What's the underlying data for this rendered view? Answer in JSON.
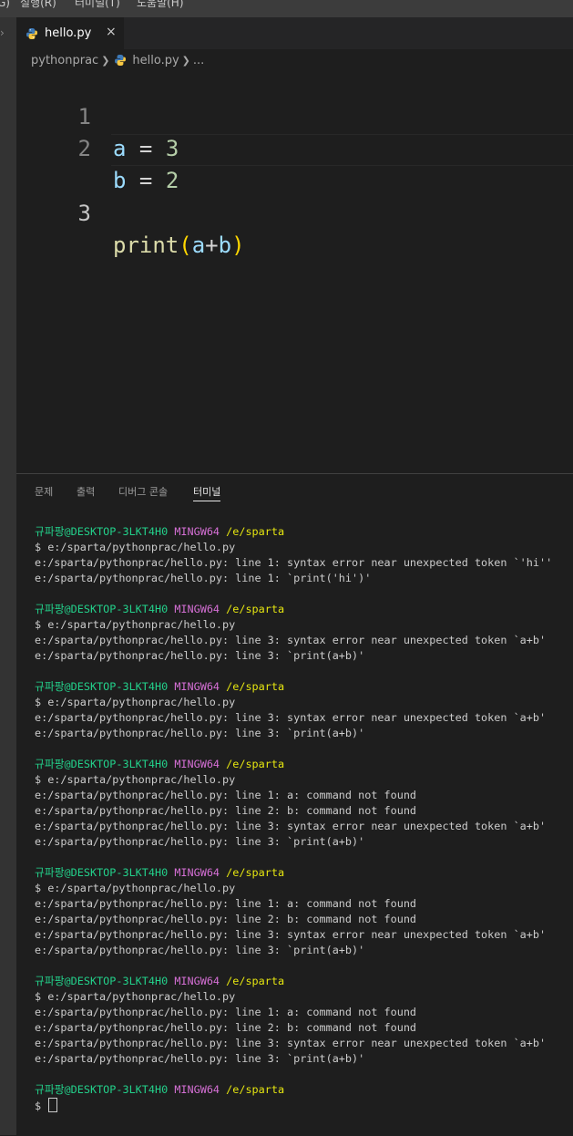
{
  "menu": [
    "G)",
    "실행(R)",
    "터미널(T)",
    "도움말(H)"
  ],
  "tab": {
    "label": "hello.py",
    "close": "×"
  },
  "breadcrumb": {
    "folder": "pythonprac",
    "file": "hello.py",
    "more": "..."
  },
  "editor": {
    "line_numbers": [
      "1",
      "2",
      "3"
    ],
    "line1": {
      "var": "a",
      "op": " = ",
      "num": "3"
    },
    "line2": {
      "var": "b",
      "op": " = ",
      "num": "2"
    },
    "line3": {
      "fn": "print",
      "open": "(",
      "a": "a",
      "plus": "+",
      "b": "b",
      "close": ")"
    }
  },
  "panel_tabs": [
    "문제",
    "출력",
    "디버그 콘솔",
    "터미널"
  ],
  "active_panel_tab": "터미널",
  "prompt": {
    "user": "규파팡@DESKTOP-3LKT4H0",
    "system": "MINGW64",
    "path": "/e/sparta"
  },
  "terminal_blocks": [
    {
      "command": "$ e:/sparta/pythonprac/hello.py",
      "output": [
        "e:/sparta/pythonprac/hello.py: line 1: syntax error near unexpected token `'hi''",
        "e:/sparta/pythonprac/hello.py: line 1: `print('hi')'"
      ]
    },
    {
      "command": "$ e:/sparta/pythonprac/hello.py",
      "output": [
        "e:/sparta/pythonprac/hello.py: line 3: syntax error near unexpected token `a+b'",
        "e:/sparta/pythonprac/hello.py: line 3: `print(a+b)'"
      ]
    },
    {
      "command": "$ e:/sparta/pythonprac/hello.py",
      "output": [
        "e:/sparta/pythonprac/hello.py: line 3: syntax error near unexpected token `a+b'",
        "e:/sparta/pythonprac/hello.py: line 3: `print(a+b)'"
      ]
    },
    {
      "command": "$ e:/sparta/pythonprac/hello.py",
      "output": [
        "e:/sparta/pythonprac/hello.py: line 1: a: command not found",
        "e:/sparta/pythonprac/hello.py: line 2: b: command not found",
        "e:/sparta/pythonprac/hello.py: line 3: syntax error near unexpected token `a+b'",
        "e:/sparta/pythonprac/hello.py: line 3: `print(a+b)'"
      ]
    },
    {
      "command": "$ e:/sparta/pythonprac/hello.py",
      "output": [
        "e:/sparta/pythonprac/hello.py: line 1: a: command not found",
        "e:/sparta/pythonprac/hello.py: line 2: b: command not found",
        "e:/sparta/pythonprac/hello.py: line 3: syntax error near unexpected token `a+b'",
        "e:/sparta/pythonprac/hello.py: line 3: `print(a+b)'"
      ]
    },
    {
      "command": "$ e:/sparta/pythonprac/hello.py",
      "output": [
        "e:/sparta/pythonprac/hello.py: line 1: a: command not found",
        "e:/sparta/pythonprac/hello.py: line 2: b: command not found",
        "e:/sparta/pythonprac/hello.py: line 3: syntax error near unexpected token `a+b'",
        "e:/sparta/pythonprac/hello.py: line 3: `print(a+b)'"
      ]
    }
  ],
  "final_input": "$ ",
  "colors": {
    "prompt_user": "#23d18b",
    "prompt_system": "#d670d6",
    "prompt_path": "#e5e510"
  },
  "icons": {
    "file": "python-icon"
  }
}
